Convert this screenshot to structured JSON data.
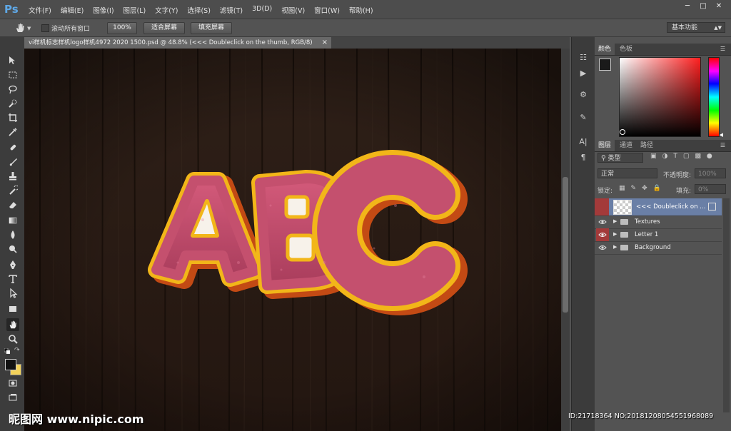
{
  "app": {
    "logo": "Ps"
  },
  "menu": [
    "文件(F)",
    "编辑(E)",
    "图像(I)",
    "图层(L)",
    "文字(Y)",
    "选择(S)",
    "滤镜(T)",
    "3D(D)",
    "视图(V)",
    "窗口(W)",
    "帮助(H)"
  ],
  "options": {
    "scroll_all_label": "滚动所有窗口",
    "zoom_100": "100%",
    "fit_screen": "适合屏幕",
    "fill_screen": "填充屏幕",
    "workspace": "基本功能"
  },
  "document": {
    "tab_title": "vi样机标志样机logo样机4972 2020 1500.psd @ 48.8% (<<< Doubleclick on the thumb, RGB/8)",
    "close_glyph": "×"
  },
  "artwork": {
    "letters": "ABC",
    "face_color": "#c4506e",
    "rim_color": "#f2b619",
    "wood_color": "#2a1c14"
  },
  "color_panel": {
    "tabs": [
      "颜色",
      "色板"
    ],
    "fg": "#1a1a1a",
    "bg": "#f3d25a"
  },
  "layers_panel": {
    "tabs": [
      "图层",
      "通道",
      "路径"
    ],
    "filter_kind": "类型",
    "blend_mode": "正常",
    "opacity_label": "不透明度:",
    "opacity_value": "100%",
    "lock_label": "锁定:",
    "fill_label": "填充:",
    "fill_value": "0%",
    "layers": [
      {
        "name": "<<< Doubleclick on ...",
        "type": "smart",
        "selected": true
      },
      {
        "name": "Textures",
        "type": "group"
      },
      {
        "name": "Letter 1",
        "type": "group"
      },
      {
        "name": "Background",
        "type": "group"
      }
    ]
  },
  "watermark": {
    "left": "昵图网 www.nipic.com",
    "right": "ID:21718364 NO:20181208054551968089"
  }
}
